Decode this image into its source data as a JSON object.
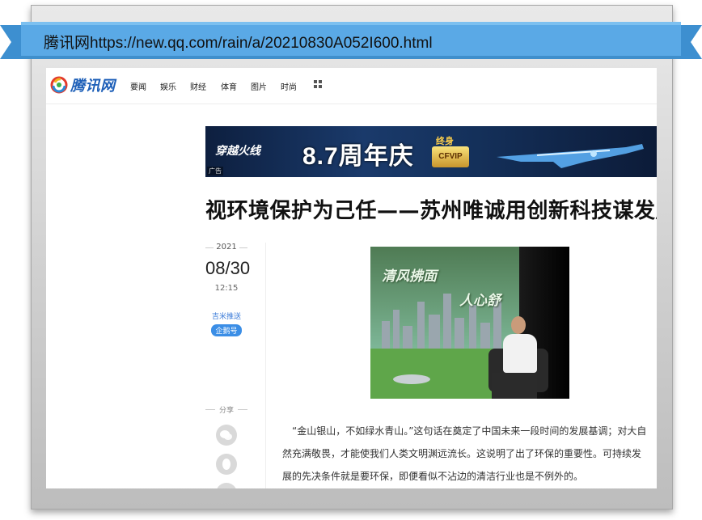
{
  "ribbon": {
    "url": "腾讯网https://new.qq.com/rain/a/20210830A052I600.html",
    "color": "#5aa9e6"
  },
  "nav": {
    "logo_text": "腾讯网",
    "items": [
      "要闻",
      "娱乐",
      "财经",
      "体育",
      "图片",
      "时尚"
    ],
    "more_icon": "grid-icon"
  },
  "banner": {
    "brand": "穿越火线",
    "anniversary": "8.7周年庆",
    "lifelong": "终身",
    "vip": "CFVIP",
    "ad_label": "广告"
  },
  "article": {
    "title": "视环境保护为己任——苏州唯诚用创新科技谋发展",
    "year": "2021",
    "date": "08/30",
    "time": "12:15",
    "source": "吉米推送",
    "badge": "企鹅号",
    "share_label": "分享",
    "share_icons": [
      "wechat-icon",
      "qq-icon",
      "qzone-icon"
    ],
    "image_caption_line1": "清风拂面",
    "image_caption_line2": "人心舒",
    "paragraph": "“金山银山，不如绿水青山。”这句话在奠定了中国未来一段时间的发展基调；对大自然充满敬畏，才能使我们人类文明渊远流长。这说明了出了环保的重要性。可持续发展的先决条件就是要环保，即便看似不沾边的清洁行业也是不例外的。"
  }
}
